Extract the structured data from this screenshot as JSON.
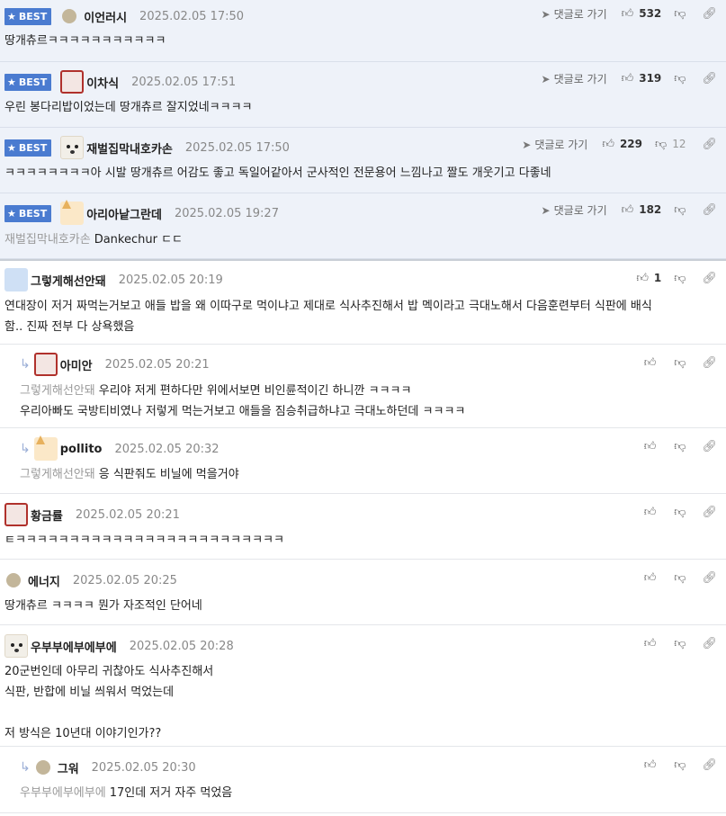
{
  "best_label": "BEST",
  "goto_label": "댓글로 가기",
  "best_comments": [
    {
      "nick": "이언러시",
      "time": "2025.02.05 17:50",
      "text": "땅개츄르ㅋㅋㅋㅋㅋㅋㅋㅋㅋㅋㅋ",
      "likes": "532",
      "dislikes": "",
      "avatar": "dot"
    },
    {
      "nick": "이차식",
      "time": "2025.02.05 17:51",
      "text": "우린 봉다리밥이었는데 땅개츄르 잘지었네ㅋㅋㅋㅋ",
      "likes": "319",
      "dislikes": "",
      "avatar": "red"
    },
    {
      "nick": "재벌집막내호카손",
      "time": "2025.02.05 17:50",
      "text": "ㅋㅋㅋㅋㅋㅋㅋㅋ아 시발 땅개츄르 어감도 좋고 독일어같아서 군사적인 전문용어 느낌나고 짤도 개웃기고 다좋네",
      "likes": "229",
      "dislikes": "12",
      "avatar": "dog"
    },
    {
      "nick": "아리아낱그란데",
      "time": "2025.02.05 19:27",
      "mention": "재벌집막내호카손",
      "text": "Dankechur ㄷㄷ",
      "likes": "182",
      "dislikes": "",
      "avatar": "corgi"
    }
  ],
  "comments": [
    {
      "nick": "그렇게해선안돼",
      "time": "2025.02.05 20:19",
      "line1": "연대장이 저거 짜먹는거보고 애들 밥을 왜 이따구로 먹이냐고 제대로 식사추진해서 밥 멕이라고 극대노해서 다음훈련부터 식판에 배식",
      "line2": "함.. 진짜 전부 다 상욕했음",
      "likes": "1",
      "avatar": "blue"
    },
    {
      "nick": "아미안",
      "time": "2025.02.05 20:21",
      "mention": "그렇게해선안돼",
      "line1": "우리야 저게 편하다만 위에서보면 비인륜적이긴 하니깐 ㅋㅋㅋㅋ",
      "line2": "우리아빠도 국방티비였나 저렇게 먹는거보고 애들을 짐승취급하냐고 극대노하던데 ㅋㅋㅋㅋ",
      "avatar": "red"
    },
    {
      "nick": "pollito",
      "time": "2025.02.05 20:32",
      "mention": "그렇게해선안돼",
      "line1": "응 식판줘도 비닐에 먹을거야",
      "avatar": "corgi"
    },
    {
      "nick": "황금률",
      "time": "2025.02.05 20:21",
      "line1": "ㅌㅋㅋㅋㅋㅋㅋㅋㅋㅋㅋㅋㅋㅋㅋㅋㅋㅋㅋㅋㅋㅋㅋㅋㅋㅋ",
      "avatar": "red"
    },
    {
      "nick": "에너지",
      "time": "2025.02.05 20:25",
      "line1": "땅개츄르 ㅋㅋㅋㅋ 뭔가 자조적인 단어네",
      "avatar": "dot"
    },
    {
      "nick": "우부부에부에부에",
      "time": "2025.02.05 20:28",
      "line1": "20군번인데 아무리 귀찮아도 식사추진해서",
      "line2": "식판, 반합에 비닐 씌워서 먹었는데",
      "line3": "저 방식은 10년대 이야기인가??",
      "avatar": "dog"
    },
    {
      "nick": "그워",
      "time": "2025.02.05 20:30",
      "mention": "우부부에부에부에",
      "line1": "17인데 저거 자주 먹었음",
      "avatar": "dot"
    }
  ],
  "icons": {
    "like": "thumbs-up-icon",
    "dislike": "thumbs-down-icon",
    "link": "link-icon",
    "goto": "arrow-icon",
    "reply": "reply-arrow-icon"
  },
  "colors": {
    "best_badge": "#4a7bd0",
    "best_bg": "#eef2f9",
    "mention": "#9a9a9a"
  }
}
